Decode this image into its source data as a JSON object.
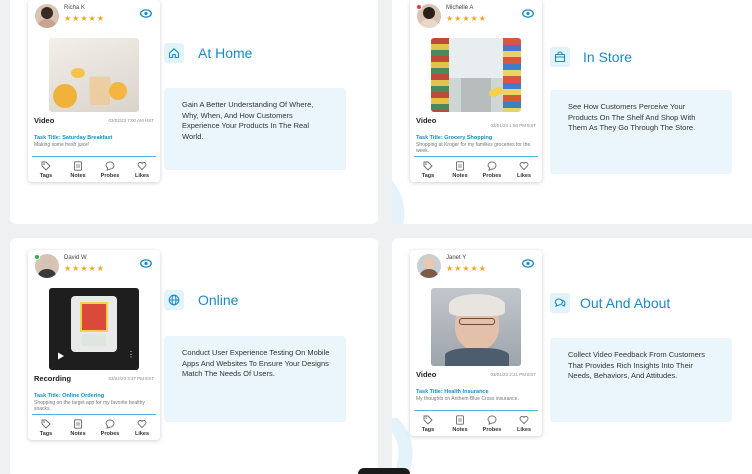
{
  "cards": [
    {
      "user": "Richa K",
      "stars": "★★★★★",
      "media_type": "Video",
      "date": "03/02/23 7:00 AM HST",
      "task_title": "Task Title: Saturday Breakfast",
      "task_desc": "Making some fresh juice!",
      "feature_title": "At Home",
      "feature_icon": "home-icon",
      "description": "Gain A Better Understanding Of Where, Why, When, And How Customers Experience Your Products In The Real World."
    },
    {
      "user": "Michelle A",
      "stars": "★★★★★",
      "media_type": "Video",
      "date": "03/01/23 1:50 PM EST",
      "task_title": "Task Title: Grocery Shopping",
      "task_desc": "Shopping at Kroger for my families groceries for the week.",
      "feature_title": "In Store",
      "feature_icon": "shopping-bag-icon",
      "description": "See How Customers Perceive Your Products On The Shelf And Shop With Them As They Go Through The Store."
    },
    {
      "user": "David W",
      "stars": "★★★★★",
      "media_type": "Recording",
      "date": "03/02/23 3:37 PM EST",
      "task_title": "Task Title: Online Ordering",
      "task_desc": "Shopping on the target app for my favorite healthy snacks.",
      "feature_title": "Online",
      "feature_icon": "globe-icon",
      "description": "Conduct User Experience Testing On Mobile Apps And Websites To Ensure Your Designs Match The Needs Of Users."
    },
    {
      "user": "Janet Y",
      "stars": "★★★★★",
      "media_type": "Video",
      "date": "03/01/23 2:21 PM EST",
      "task_title": "Task Title: Health Insurance",
      "task_desc": "My thoughts on Anthem Blue Cross insurance.",
      "feature_title": "Out And About",
      "feature_icon": "chat-bubbles-icon",
      "description": "Collect Video Feedback From Customers That Provides Rich Insights Into Their Needs, Behaviors, And Attitudes."
    }
  ],
  "actions": {
    "tags": "Tags",
    "notes": "Notes",
    "probes": "Probes",
    "likes": "Likes"
  },
  "colors": {
    "accent": "#1a8bc2",
    "star": "#f5a524",
    "desc_bg": "#eaf6fc"
  }
}
